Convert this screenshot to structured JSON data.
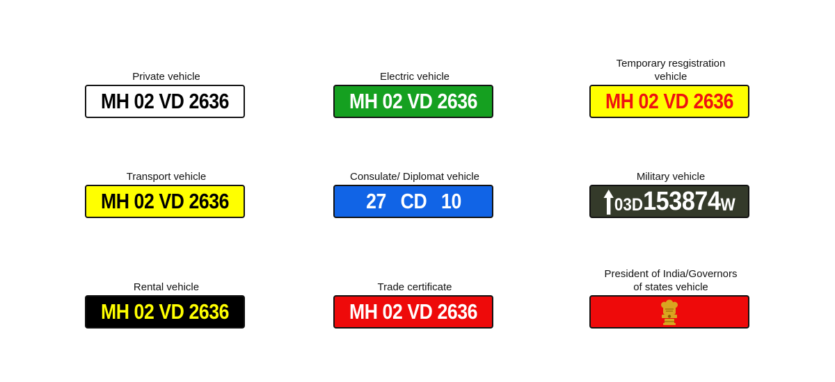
{
  "plates": [
    {
      "id": "private",
      "caption": "Private vehicle",
      "text": "MH 02 VD 2636",
      "bg": "#ffffff",
      "fg": "#000000"
    },
    {
      "id": "electric",
      "caption": "Electric vehicle",
      "text": "MH 02 VD 2636",
      "bg": "#15a020",
      "fg": "#ffffff"
    },
    {
      "id": "temporary",
      "caption": "Temporary resgistration\nvehicle",
      "text": "MH 02 VD 2636",
      "bg": "#ffff00",
      "fg": "#ee1111"
    },
    {
      "id": "transport",
      "caption": "Transport vehicle",
      "text": "MH 02 VD 2636",
      "bg": "#ffff00",
      "fg": "#000000"
    },
    {
      "id": "diplomat",
      "caption": "Consulate/ Diplomat vehicle",
      "text": "27 CD 10",
      "bg": "#1164e6",
      "fg": "#ffffff"
    },
    {
      "id": "military",
      "caption": "Military vehicle",
      "text_small": "03D",
      "text_big": "153874",
      "text_suffix": "W",
      "bg": "#343a2a",
      "fg": "#ffffff",
      "icon": "up-arrow-icon"
    },
    {
      "id": "rental",
      "caption": "Rental vehicle",
      "text": "MH 02 VD 2636",
      "bg": "#000000",
      "fg": "#ffff00"
    },
    {
      "id": "trade",
      "caption": "Trade certificate",
      "text": "MH 02 VD 2636",
      "bg": "#ee0a0a",
      "fg": "#ffffff"
    },
    {
      "id": "president",
      "caption": "President of India/Governors\nof states vehicle",
      "bg": "#ee0a0a",
      "icon": "national-emblem-icon",
      "emblem_color": "#d9a520"
    }
  ]
}
